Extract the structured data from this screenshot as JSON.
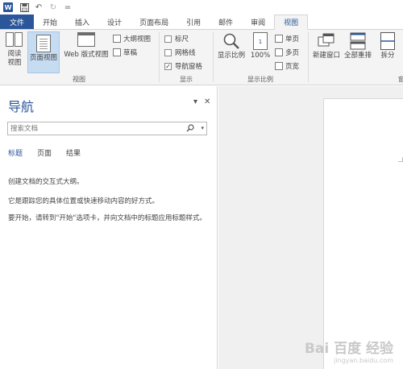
{
  "titlebar": {
    "app_icon_letter": "W",
    "undo_glyph": "↶",
    "redo_glyph": "↻",
    "customize_glyph": "="
  },
  "tabs": [
    "文件",
    "开始",
    "插入",
    "设计",
    "页面布局",
    "引用",
    "邮件",
    "审阅",
    "视图"
  ],
  "active_tab": "视图",
  "ribbon": {
    "views": {
      "label": "视图",
      "read_mode": "阅读\n视图",
      "print_layout": "页面视图",
      "web_layout": "Web 版式视图",
      "outline": "大纲视图",
      "draft": "草稿"
    },
    "show": {
      "label": "显示",
      "ruler": "标尺",
      "ruler_checked": false,
      "gridlines": "网格线",
      "gridlines_checked": false,
      "nav_pane": "导航窗格",
      "nav_pane_checked": true,
      "check_glyph": "✓"
    },
    "zoom": {
      "label": "显示比例",
      "zoom": "显示比例",
      "hundred": "100%",
      "one_page": "单页",
      "multi_page": "多页",
      "page_width": "页宽"
    },
    "window": {
      "new_window": "新建窗口",
      "arrange_all": "全部重排",
      "split": "拆分",
      "partial_label": "窗"
    }
  },
  "nav": {
    "title": "导航",
    "dropdown_glyph": "▾",
    "close_glyph": "✕",
    "search_placeholder": "搜索文档",
    "tabs": [
      "标题",
      "页面",
      "结果"
    ],
    "active_tab": "标题",
    "line1": "创建文档的交互式大纲。",
    "line2": "它是跟踪您的具体位置或快速移动内容的好方式。",
    "line3": "要开始，请转到\"开始\"选项卡，并向文档中的标题应用标题样式。"
  },
  "watermark": {
    "main": "Bai 百度 经验",
    "sub": "jingyan.baidu.com"
  },
  "colors": {
    "accent": "#2b579a",
    "ribbon_bg": "#f4f4f4",
    "selected_btn": "#c6dcf1"
  }
}
